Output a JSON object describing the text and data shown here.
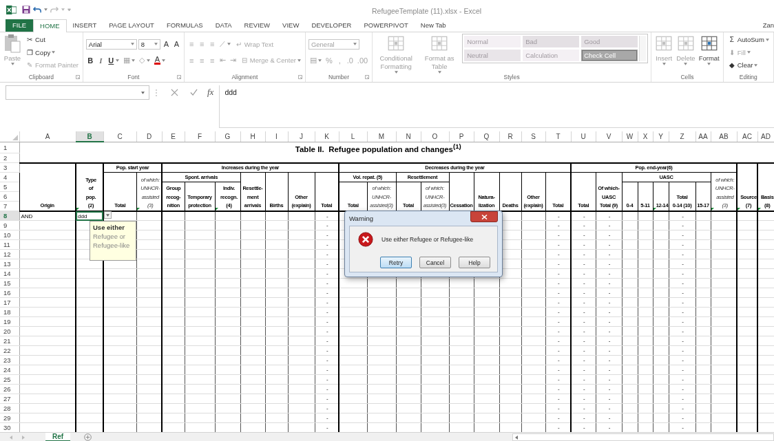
{
  "window": {
    "title": "RefugeeTemplate (11).xlsx - Excel",
    "user": "Zan"
  },
  "tabs": [
    {
      "label": "FILE",
      "kind": "file",
      "selected": false
    },
    {
      "label": "HOME",
      "kind": "tab",
      "selected": true
    },
    {
      "label": "INSERT",
      "kind": "tab",
      "selected": false
    },
    {
      "label": "PAGE LAYOUT",
      "kind": "tab",
      "selected": false
    },
    {
      "label": "FORMULAS",
      "kind": "tab",
      "selected": false
    },
    {
      "label": "DATA",
      "kind": "tab",
      "selected": false
    },
    {
      "label": "REVIEW",
      "kind": "tab",
      "selected": false
    },
    {
      "label": "VIEW",
      "kind": "tab",
      "selected": false
    },
    {
      "label": "DEVELOPER",
      "kind": "tab",
      "selected": false
    },
    {
      "label": "POWERPIVOT",
      "kind": "tab",
      "selected": false
    },
    {
      "label": "New Tab",
      "kind": "tab",
      "selected": false
    }
  ],
  "ribbon": [
    {
      "label": "Clipboard",
      "launcher": true,
      "blocks": [
        {
          "kind": "paste",
          "label": "Paste",
          "disabled": true,
          "dropdown": true
        },
        {
          "kind": "stack",
          "rows": [
            {
              "tools": [
                {
                  "kind": "small",
                  "glyph": "✂",
                  "label": "Cut",
                  "disabled": false,
                  "dropdown": false
                }
              ]
            },
            {
              "tools": [
                {
                  "kind": "small",
                  "glyph": "❐",
                  "label": "Copy",
                  "disabled": false,
                  "dropdown": true
                }
              ]
            },
            {
              "tools": [
                {
                  "kind": "small",
                  "glyph": "✎",
                  "label": "Format Painter",
                  "disabled": true,
                  "dropdown": false
                }
              ]
            }
          ]
        }
      ]
    },
    {
      "label": "Font",
      "launcher": true,
      "blocks": [
        {
          "kind": "stack",
          "rows": [
            {
              "tools": [
                {
                  "kind": "field",
                  "value": "Arial",
                  "disabled": false,
                  "dropdown": true
                },
                {
                  "kind": "field",
                  "value": "8",
                  "disabled": false,
                  "dropdown": true
                },
                {
                  "kind": "glyph",
                  "label": "A",
                  "disabled": false,
                  "dropdown": false
                },
                {
                  "kind": "glyph",
                  "label": "A",
                  "disabled": false,
                  "dropdown": false
                }
              ]
            },
            {
              "tools": [
                {
                  "kind": "bold",
                  "label": "B",
                  "disabled": false,
                  "dropdown": false
                },
                {
                  "kind": "italic",
                  "label": "I",
                  "disabled": false,
                  "dropdown": false
                },
                {
                  "kind": "underline",
                  "label": "U",
                  "disabled": false,
                  "dropdown": true
                },
                {
                  "kind": "glyph",
                  "label": "▦",
                  "disabled": true,
                  "dropdown": true
                },
                {
                  "kind": "glyph",
                  "label": "◇",
                  "disabled": true,
                  "dropdown": true
                },
                {
                  "kind": "fontcolor",
                  "label": "A",
                  "disabled": false,
                  "dropdown": true
                }
              ]
            }
          ]
        }
      ]
    },
    {
      "label": "Alignment",
      "launcher": true,
      "blocks": [
        {
          "kind": "stack",
          "rows": [
            {
              "tools": [
                {
                  "kind": "glyph",
                  "label": "≡",
                  "disabled": true,
                  "dropdown": false
                },
                {
                  "kind": "glyph",
                  "label": "≡",
                  "disabled": true,
                  "dropdown": false
                },
                {
                  "kind": "glyph",
                  "label": "≡",
                  "disabled": true,
                  "dropdown": false
                },
                {
                  "kind": "glyph",
                  "label": "⟋",
                  "disabled": true,
                  "dropdown": true
                },
                {
                  "kind": "small",
                  "glyph": "↵",
                  "label": "Wrap Text",
                  "disabled": true,
                  "dropdown": false
                }
              ]
            },
            {
              "tools": [
                {
                  "kind": "glyph",
                  "label": "≡",
                  "disabled": true,
                  "dropdown": false
                },
                {
                  "kind": "glyph",
                  "label": "≡",
                  "disabled": true,
                  "dropdown": false
                },
                {
                  "kind": "glyph",
                  "label": "≡",
                  "disabled": true,
                  "dropdown": false
                },
                {
                  "kind": "glyph",
                  "label": "⇤",
                  "disabled": true,
                  "dropdown": false
                },
                {
                  "kind": "glyph",
                  "label": "⇥",
                  "disabled": true,
                  "dropdown": false
                },
                {
                  "kind": "small",
                  "glyph": "⊟",
                  "label": "Merge & Center",
                  "disabled": true,
                  "dropdown": true
                }
              ]
            }
          ]
        }
      ]
    },
    {
      "label": "Number",
      "launcher": true,
      "blocks": [
        {
          "kind": "stack",
          "rows": [
            {
              "tools": [
                {
                  "kind": "field",
                  "value": "General",
                  "disabled": true,
                  "dropdown": true
                }
              ]
            },
            {
              "tools": [
                {
                  "kind": "glyph",
                  "label": "▤",
                  "disabled": true,
                  "dropdown": true
                },
                {
                  "kind": "glyph",
                  "label": "%",
                  "disabled": true,
                  "dropdown": false
                },
                {
                  "kind": "glyph",
                  "label": ",",
                  "disabled": true,
                  "dropdown": false
                },
                {
                  "kind": "glyph",
                  "label": ".0",
                  "disabled": true,
                  "dropdown": false
                },
                {
                  "kind": "glyph",
                  "label": ".00",
                  "disabled": true,
                  "dropdown": false
                }
              ]
            }
          ]
        }
      ]
    },
    {
      "label": "Styles",
      "launcher": false,
      "blocks": [
        {
          "kind": "large",
          "label": "Conditional Formatting",
          "disabled": true,
          "dropdown": true
        },
        {
          "kind": "large",
          "label": "Format as Table",
          "disabled": true,
          "dropdown": true
        },
        {
          "kind": "gallery",
          "styles": [
            {
              "label": "Normal",
              "color": "#f4f0f4"
            },
            {
              "label": "Bad",
              "color": "#e4e0e4"
            },
            {
              "label": "Good",
              "color": "#e4e0e4"
            },
            {
              "label": "Neutral",
              "color": "#e9e5e9"
            },
            {
              "label": "Calculation",
              "color": "#f4f0f4"
            },
            {
              "label": "Check Cell",
              "color": "#a8a8a8"
            }
          ]
        }
      ]
    },
    {
      "label": "Cells",
      "launcher": false,
      "blocks": [
        {
          "kind": "large",
          "label": "Insert",
          "disabled": true,
          "dropdown": true
        },
        {
          "kind": "large",
          "label": "Delete",
          "disabled": true,
          "dropdown": true
        },
        {
          "kind": "large",
          "label": "Format",
          "disabled": false,
          "dropdown": true
        }
      ]
    },
    {
      "label": "Editing",
      "launcher": false,
      "blocks": [
        {
          "kind": "stack",
          "rows": [
            {
              "tools": [
                {
                  "kind": "small",
                  "glyph": "Σ",
                  "label": "AutoSum",
                  "disabled": false,
                  "dropdown": true
                }
              ]
            },
            {
              "tools": [
                {
                  "kind": "small",
                  "glyph": "⬇",
                  "label": "Fill",
                  "disabled": true,
                  "dropdown": true
                }
              ]
            },
            {
              "tools": [
                {
                  "kind": "small",
                  "glyph": "◆",
                  "label": "Clear",
                  "disabled": false,
                  "dropdown": true
                }
              ]
            }
          ]
        }
      ]
    }
  ],
  "formula_bar": {
    "function_label": "fx",
    "value": "ddd"
  },
  "columns": [
    {
      "label": "A",
      "selected": false
    },
    {
      "label": "B",
      "selected": true
    },
    {
      "label": "C",
      "selected": false
    },
    {
      "label": "D",
      "selected": false
    },
    {
      "label": "E",
      "selected": false
    },
    {
      "label": "F",
      "selected": false
    },
    {
      "label": "G",
      "selected": false
    },
    {
      "label": "H",
      "selected": false
    },
    {
      "label": "I",
      "selected": false
    },
    {
      "label": "J",
      "selected": false
    },
    {
      "label": "K",
      "selected": false
    },
    {
      "label": "L",
      "selected": false
    },
    {
      "label": "M",
      "selected": false
    },
    {
      "label": "N",
      "selected": false
    },
    {
      "label": "O",
      "selected": false
    },
    {
      "label": "P",
      "selected": false
    },
    {
      "label": "Q",
      "selected": false
    },
    {
      "label": "R",
      "selected": false
    },
    {
      "label": "S",
      "selected": false
    },
    {
      "label": "T",
      "selected": false
    },
    {
      "label": "U",
      "selected": false
    },
    {
      "label": "V",
      "selected": false
    },
    {
      "label": "W",
      "selected": false
    },
    {
      "label": "X",
      "selected": false
    },
    {
      "label": "Y",
      "selected": false
    },
    {
      "label": "Z",
      "selected": false
    },
    {
      "label": "AA",
      "selected": false
    },
    {
      "label": "AB",
      "selected": false
    },
    {
      "label": "AC",
      "selected": false
    },
    {
      "label": "AD",
      "selected": false
    }
  ],
  "sheet": {
    "title": "Table II.  Refugee population and changes$^{(1)}$",
    "title_rows": [
      "1",
      "2"
    ],
    "header_rows": [
      "3",
      "4",
      "5",
      "6",
      "7"
    ],
    "header": [
      {
        "lines": [
          "Origin"
        ],
        "italic": false,
        "flagged": false
      },
      {
        "lines": [
          "Type",
          "of",
          "pop.",
          "(2)"
        ],
        "italic": false,
        "flagged": true
      },
      {
        "lines": [
          "Pop. start year"
        ],
        "children": [
          {
            "lines": [
              "Total"
            ],
            "italic": false,
            "flagged": false
          },
          {
            "lines": [
              "of which:",
              "UNHCR-",
              "assisted",
              "(3)"
            ],
            "italic": true,
            "flagged": true
          }
        ]
      },
      {
        "lines": [
          "Increases during the year"
        ],
        "children": [
          {
            "lines": [
              "Spont. arrivals"
            ],
            "children": [
              {
                "lines": [
                  "Group",
                  "recog-",
                  "nition"
                ],
                "italic": false,
                "flagged": false
              },
              {
                "lines": [
                  "Temporary",
                  "protection"
                ],
                "italic": false,
                "flagged": false
              },
              {
                "lines": [
                  "Indiv.",
                  "recogn.",
                  "(4)"
                ],
                "italic": false,
                "flagged": true
              }
            ]
          },
          {
            "lines": [
              "Resettle-",
              "ment",
              "arrivals"
            ],
            "italic": false,
            "flagged": false
          },
          {
            "lines": [
              "Births"
            ],
            "italic": false,
            "flagged": false
          },
          {
            "lines": [
              "Other",
              "(explain)"
            ],
            "italic": false,
            "flagged": false
          },
          {
            "lines": [
              "Total"
            ],
            "italic": false,
            "flagged": false
          }
        ]
      },
      {
        "lines": [
          "Decreases during the year"
        ],
        "children": [
          {
            "lines": [
              "Vol. repat. (5)"
            ],
            "children": [
              {
                "lines": [
                  "Total"
                ],
                "italic": false,
                "flagged": false
              },
              {
                "lines": [
                  "of which:",
                  "UNHCR-",
                  "assisted(3)"
                ],
                "italic": true,
                "flagged": false
              }
            ]
          },
          {
            "lines": [
              "Resettlement"
            ],
            "children": [
              {
                "lines": [
                  "Total"
                ],
                "italic": false,
                "flagged": false
              },
              {
                "lines": [
                  "of which:",
                  "UNHCR-",
                  "assisted(3)"
                ],
                "italic": true,
                "flagged": false
              }
            ]
          },
          {
            "lines": [
              "Cessation"
            ],
            "italic": false,
            "flagged": false
          },
          {
            "lines": [
              "Natura-",
              "lization"
            ],
            "italic": false,
            "flagged": false
          },
          {
            "lines": [
              "Deaths"
            ],
            "italic": false,
            "flagged": false
          },
          {
            "lines": [
              "Other",
              "(explain)"
            ],
            "italic": false,
            "flagged": false
          },
          {
            "lines": [
              "Total"
            ],
            "italic": false,
            "flagged": false
          }
        ]
      },
      {
        "lines": [
          "Pop. end-year(6)"
        ],
        "children": [
          {
            "lines": [
              "Total"
            ],
            "italic": false,
            "flagged": false
          },
          {
            "lines": [
              "Of which-",
              "UASC",
              "Total (9)"
            ],
            "italic": false,
            "flagged": false
          },
          {
            "lines": [
              "UASC"
            ],
            "children": [
              {
                "lines": [
                  "0-4"
                ],
                "italic": false,
                "flagged": false
              },
              {
                "lines": [
                  "5-11"
                ],
                "italic": false,
                "flagged": false
              },
              {
                "lines": [
                  "12-14"
                ],
                "italic": false,
                "flagged": true
              },
              {
                "lines": [
                  "Total",
                  "0-14 (10)"
                ],
                "italic": false,
                "flagged": false
              },
              {
                "lines": [
                  "15-17"
                ],
                "italic": false,
                "flagged": false
              }
            ]
          },
          {
            "lines": [
              "of which:",
              "UNHCR-",
              "assisted",
              "(3)"
            ],
            "italic": true,
            "flagged": true
          }
        ]
      },
      {
        "lines": [
          "Source",
          "(7)"
        ],
        "italic": false,
        "flagged": true
      },
      {
        "lines": [
          "Basis",
          "(8)"
        ],
        "italic": false,
        "flagged": true
      }
    ],
    "rows": [
      {
        "number": "8",
        "selected": true,
        "cells": [
          "AND",
          "ddd",
          null,
          null,
          null,
          null,
          null,
          null,
          null,
          null,
          "-",
          null,
          null,
          null,
          null,
          null,
          null,
          null,
          null,
          "-",
          "-",
          "-",
          null,
          null,
          null,
          "-",
          null,
          null,
          null,
          null
        ]
      },
      {
        "number": "9",
        "selected": false,
        "cells": [
          null,
          null,
          null,
          null,
          null,
          null,
          null,
          null,
          null,
          null,
          "-",
          null,
          null,
          null,
          null,
          null,
          null,
          null,
          null,
          "-",
          "-",
          "-",
          null,
          null,
          null,
          "-",
          null,
          null,
          null,
          null
        ]
      },
      {
        "number": "10",
        "selected": false,
        "cells": [
          null,
          null,
          null,
          null,
          null,
          null,
          null,
          null,
          null,
          null,
          "-",
          null,
          null,
          null,
          null,
          null,
          null,
          null,
          null,
          "-",
          "-",
          "-",
          null,
          null,
          null,
          "-",
          null,
          null,
          null,
          null
        ]
      },
      {
        "number": "11",
        "selected": false,
        "cells": [
          null,
          null,
          null,
          null,
          null,
          null,
          null,
          null,
          null,
          null,
          "-",
          null,
          null,
          null,
          null,
          null,
          null,
          null,
          null,
          "-",
          "-",
          "-",
          null,
          null,
          null,
          "-",
          null,
          null,
          null,
          null
        ]
      },
      {
        "number": "12",
        "selected": false,
        "cells": [
          null,
          null,
          null,
          null,
          null,
          null,
          null,
          null,
          null,
          null,
          "-",
          null,
          null,
          null,
          null,
          null,
          null,
          null,
          null,
          "-",
          "-",
          "-",
          null,
          null,
          null,
          "-",
          null,
          null,
          null,
          null
        ]
      },
      {
        "number": "13",
        "selected": false,
        "cells": [
          null,
          null,
          null,
          null,
          null,
          null,
          null,
          null,
          null,
          null,
          "-",
          null,
          null,
          null,
          null,
          null,
          null,
          null,
          null,
          "-",
          "-",
          "-",
          null,
          null,
          null,
          "-",
          null,
          null,
          null,
          null
        ]
      },
      {
        "number": "14",
        "selected": false,
        "cells": [
          null,
          null,
          null,
          null,
          null,
          null,
          null,
          null,
          null,
          null,
          "-",
          null,
          null,
          null,
          null,
          null,
          null,
          null,
          null,
          "-",
          "-",
          "-",
          null,
          null,
          null,
          "-",
          null,
          null,
          null,
          null
        ]
      },
      {
        "number": "15",
        "selected": false,
        "cells": [
          null,
          null,
          null,
          null,
          null,
          null,
          null,
          null,
          null,
          null,
          "-",
          null,
          null,
          null,
          null,
          null,
          null,
          null,
          null,
          "-",
          "-",
          "-",
          null,
          null,
          null,
          "-",
          null,
          null,
          null,
          null
        ]
      },
      {
        "number": "16",
        "selected": false,
        "cells": [
          null,
          null,
          null,
          null,
          null,
          null,
          null,
          null,
          null,
          null,
          "-",
          null,
          null,
          null,
          null,
          null,
          null,
          null,
          null,
          "-",
          "-",
          "-",
          null,
          null,
          null,
          "-",
          null,
          null,
          null,
          null
        ]
      },
      {
        "number": "17",
        "selected": false,
        "cells": [
          null,
          null,
          null,
          null,
          null,
          null,
          null,
          null,
          null,
          null,
          "-",
          null,
          null,
          null,
          null,
          null,
          null,
          null,
          null,
          "-",
          "-",
          "-",
          null,
          null,
          null,
          "-",
          null,
          null,
          null,
          null
        ]
      },
      {
        "number": "18",
        "selected": false,
        "cells": [
          null,
          null,
          null,
          null,
          null,
          null,
          null,
          null,
          null,
          null,
          "-",
          null,
          null,
          null,
          null,
          null,
          null,
          null,
          null,
          "-",
          "-",
          "-",
          null,
          null,
          null,
          "-",
          null,
          null,
          null,
          null
        ]
      },
      {
        "number": "19",
        "selected": false,
        "cells": [
          null,
          null,
          null,
          null,
          null,
          null,
          null,
          null,
          null,
          null,
          "-",
          null,
          null,
          null,
          null,
          null,
          null,
          null,
          null,
          "-",
          "-",
          "-",
          null,
          null,
          null,
          "-",
          null,
          null,
          null,
          null
        ]
      },
      {
        "number": "20",
        "selected": false,
        "cells": [
          null,
          null,
          null,
          null,
          null,
          null,
          null,
          null,
          null,
          null,
          "-",
          null,
          null,
          null,
          null,
          null,
          null,
          null,
          null,
          "-",
          "-",
          "-",
          null,
          null,
          null,
          "-",
          null,
          null,
          null,
          null
        ]
      },
      {
        "number": "21",
        "selected": false,
        "cells": [
          null,
          null,
          null,
          null,
          null,
          null,
          null,
          null,
          null,
          null,
          "-",
          null,
          null,
          null,
          null,
          null,
          null,
          null,
          null,
          "-",
          "-",
          "-",
          null,
          null,
          null,
          "-",
          null,
          null,
          null,
          null
        ]
      },
      {
        "number": "22",
        "selected": false,
        "cells": [
          null,
          null,
          null,
          null,
          null,
          null,
          null,
          null,
          null,
          null,
          "-",
          null,
          null,
          null,
          null,
          null,
          null,
          null,
          null,
          "-",
          "-",
          "-",
          null,
          null,
          null,
          "-",
          null,
          null,
          null,
          null
        ]
      },
      {
        "number": "23",
        "selected": false,
        "cells": [
          null,
          null,
          null,
          null,
          null,
          null,
          null,
          null,
          null,
          null,
          "-",
          null,
          null,
          null,
          null,
          null,
          null,
          null,
          null,
          "-",
          "-",
          "-",
          null,
          null,
          null,
          "-",
          null,
          null,
          null,
          null
        ]
      },
      {
        "number": "24",
        "selected": false,
        "cells": [
          null,
          null,
          null,
          null,
          null,
          null,
          null,
          null,
          null,
          null,
          "-",
          null,
          null,
          null,
          null,
          null,
          null,
          null,
          null,
          "-",
          "-",
          "-",
          null,
          null,
          null,
          "-",
          null,
          null,
          null,
          null
        ]
      },
      {
        "number": "25",
        "selected": false,
        "cells": [
          null,
          null,
          null,
          null,
          null,
          null,
          null,
          null,
          null,
          null,
          "-",
          null,
          null,
          null,
          null,
          null,
          null,
          null,
          null,
          "-",
          "-",
          "-",
          null,
          null,
          null,
          "-",
          null,
          null,
          null,
          null
        ]
      },
      {
        "number": "26",
        "selected": false,
        "cells": [
          null,
          null,
          null,
          null,
          null,
          null,
          null,
          null,
          null,
          null,
          "-",
          null,
          null,
          null,
          null,
          null,
          null,
          null,
          null,
          "-",
          "-",
          "-",
          null,
          null,
          null,
          "-",
          null,
          null,
          null,
          null
        ]
      },
      {
        "number": "27",
        "selected": false,
        "cells": [
          null,
          null,
          null,
          null,
          null,
          null,
          null,
          null,
          null,
          null,
          "-",
          null,
          null,
          null,
          null,
          null,
          null,
          null,
          null,
          "-",
          "-",
          "-",
          null,
          null,
          null,
          "-",
          null,
          null,
          null,
          null
        ]
      },
      {
        "number": "28",
        "selected": false,
        "cells": [
          null,
          null,
          null,
          null,
          null,
          null,
          null,
          null,
          null,
          null,
          "-",
          null,
          null,
          null,
          null,
          null,
          null,
          null,
          null,
          "-",
          "-",
          "-",
          null,
          null,
          null,
          "-",
          null,
          null,
          null,
          null
        ]
      },
      {
        "number": "29",
        "selected": false,
        "cells": [
          null,
          null,
          null,
          null,
          null,
          null,
          null,
          null,
          null,
          null,
          "-",
          null,
          null,
          null,
          null,
          null,
          null,
          null,
          null,
          "-",
          "-",
          "-",
          null,
          null,
          null,
          "-",
          null,
          null,
          null,
          null
        ]
      },
      {
        "number": "30",
        "selected": false,
        "cells": [
          null,
          null,
          null,
          null,
          null,
          null,
          null,
          null,
          null,
          null,
          "-",
          null,
          null,
          null,
          null,
          null,
          null,
          null,
          null,
          "-",
          "-",
          "-",
          null,
          null,
          null,
          "-",
          null,
          null,
          null,
          null
        ]
      }
    ]
  },
  "active_cell": {
    "dropdown": true,
    "input_message": {
      "title": "Use either",
      "text": "Refugee or Refugee-like"
    }
  },
  "dialog": {
    "title": "Warning",
    "message": "Use either Refugee or Refugee-like",
    "buttons": [
      {
        "label": "Retry",
        "selected": true
      },
      {
        "label": "Cancel",
        "selected": false
      },
      {
        "label": "Help",
        "selected": false
      }
    ]
  },
  "sheet_tabs": [
    {
      "label": "Ref",
      "selected": true
    }
  ]
}
